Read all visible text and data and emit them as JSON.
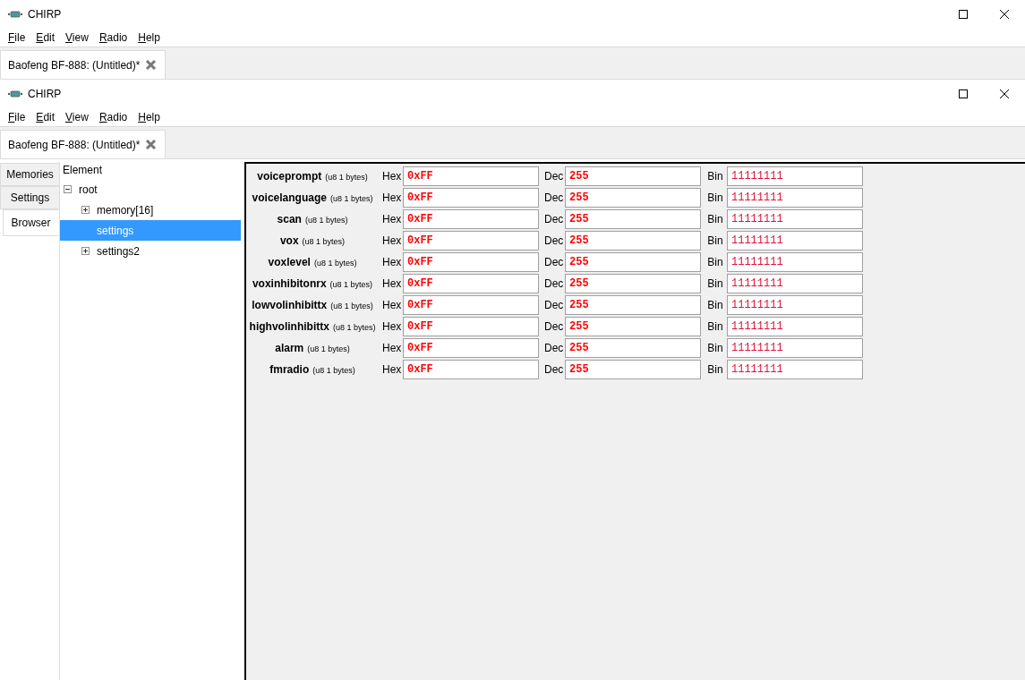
{
  "windows": [
    {
      "title": "CHIRP",
      "menu": [
        "File",
        "Edit",
        "View",
        "Radio",
        "Help"
      ],
      "tabs": [
        {
          "label": "Baofeng BF-888: (Untitled)*",
          "selected": true
        }
      ]
    },
    {
      "title": "CHIRP",
      "menu": [
        "File",
        "Edit",
        "View",
        "Radio",
        "Help"
      ],
      "tabs": [
        {
          "label": "Baofeng BF-888: (Untitled)*",
          "selected": true
        }
      ],
      "browser": {
        "side_tabs": [
          {
            "label": "Memories",
            "selected": false
          },
          {
            "label": "Settings",
            "selected": false
          },
          {
            "label": "Browser",
            "selected": true
          }
        ],
        "tree": {
          "header": "Element",
          "items": [
            {
              "label": "root",
              "kind": "branch",
              "expanded": true,
              "selected": false,
              "children": [
                {
                  "label": "memory[16]",
                  "kind": "branch",
                  "expanded": false,
                  "selected": false
                },
                {
                  "label": "settings",
                  "kind": "leaf",
                  "selected": true
                },
                {
                  "label": "settings2",
                  "kind": "branch",
                  "expanded": false,
                  "selected": false
                }
              ]
            }
          ]
        },
        "fields": [
          {
            "name": "voiceprompt",
            "type": "(u8 1 bytes)",
            "hex_label": "Hex",
            "hex": "0xFF",
            "dec_label": "Dec",
            "dec": "255",
            "bin_label": "Bin",
            "bin": "11111111"
          },
          {
            "name": "voicelanguage",
            "type": "(u8 1 bytes)",
            "hex_label": "Hex",
            "hex": "0xFF",
            "dec_label": "Dec",
            "dec": "255",
            "bin_label": "Bin",
            "bin": "11111111"
          },
          {
            "name": "scan",
            "type": "(u8 1 bytes)",
            "hex_label": "Hex",
            "hex": "0xFF",
            "dec_label": "Dec",
            "dec": "255",
            "bin_label": "Bin",
            "bin": "11111111"
          },
          {
            "name": "vox",
            "type": "(u8 1 bytes)",
            "hex_label": "Hex",
            "hex": "0xFF",
            "dec_label": "Dec",
            "dec": "255",
            "bin_label": "Bin",
            "bin": "11111111"
          },
          {
            "name": "voxlevel",
            "type": "(u8 1 bytes)",
            "hex_label": "Hex",
            "hex": "0xFF",
            "dec_label": "Dec",
            "dec": "255",
            "bin_label": "Bin",
            "bin": "11111111"
          },
          {
            "name": "voxinhibitonrx",
            "type": "(u8 1 bytes)",
            "hex_label": "Hex",
            "hex": "0xFF",
            "dec_label": "Dec",
            "dec": "255",
            "bin_label": "Bin",
            "bin": "11111111"
          },
          {
            "name": "lowvolinhibittx",
            "type": "(u8 1 bytes)",
            "hex_label": "Hex",
            "hex": "0xFF",
            "dec_label": "Dec",
            "dec": "255",
            "bin_label": "Bin",
            "bin": "11111111"
          },
          {
            "name": "highvolinhibittx",
            "type": "(u8 1 bytes)",
            "hex_label": "Hex",
            "hex": "0xFF",
            "dec_label": "Dec",
            "dec": "255",
            "bin_label": "Bin",
            "bin": "11111111"
          },
          {
            "name": "alarm",
            "type": "(u8 1 bytes)",
            "hex_label": "Hex",
            "hex": "0xFF",
            "dec_label": "Dec",
            "dec": "255",
            "bin_label": "Bin",
            "bin": "11111111"
          },
          {
            "name": "fmradio",
            "type": "(u8 1 bytes)",
            "hex_label": "Hex",
            "hex": "0xFF",
            "dec_label": "Dec",
            "dec": "255",
            "bin_label": "Bin",
            "bin": "11111111"
          }
        ]
      }
    }
  ]
}
